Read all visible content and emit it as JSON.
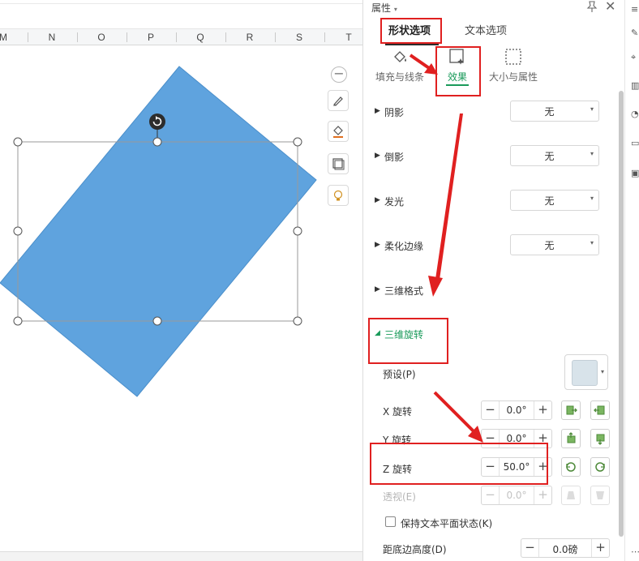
{
  "sheet": {
    "columns": [
      "M",
      "N",
      "O",
      "P",
      "Q",
      "R",
      "S",
      "T"
    ]
  },
  "panel": {
    "title": "属性",
    "tabs": {
      "shape_options": "形状选项",
      "text_options": "文本选项"
    },
    "subtabs": {
      "fill_line": "填充与线条",
      "effects": "效果",
      "size_props": "大小与属性"
    },
    "sections": [
      {
        "label": "阴影",
        "value": "无"
      },
      {
        "label": "倒影",
        "value": "无"
      },
      {
        "label": "发光",
        "value": "无"
      },
      {
        "label": "柔化边缘",
        "value": "无"
      }
    ],
    "format_3d": "三维格式",
    "rotation_3d": {
      "label": "三维旋转",
      "preset_label": "预设(P)",
      "x_label": "X 旋转",
      "x_value": "0.0°",
      "y_label": "Y 旋转",
      "y_value": "0.0°",
      "z_label": "Z 旋转",
      "z_value": "50.0°",
      "perspective_label": "透视(E)",
      "perspective_value": "0.0°",
      "keep_text_flat": "保持文本平面状态(K)",
      "distance_label": "距底边高度(D)",
      "distance_value": "0.0磅"
    }
  },
  "colors": {
    "shape_fill": "#5fa3de",
    "highlight": "#e02020",
    "accent_green": "#1a9a5a"
  }
}
